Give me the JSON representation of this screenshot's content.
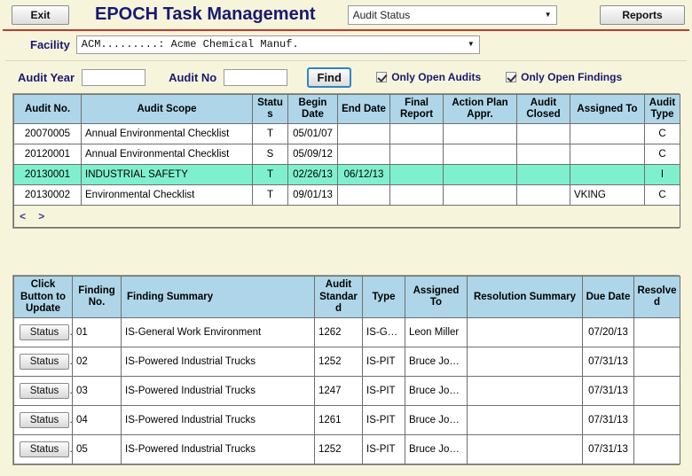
{
  "header": {
    "exit_label": "Exit",
    "app_title": "EPOCH Task Management",
    "status_select_value": "Audit Status",
    "reports_label": "Reports",
    "caret_icon": "▼"
  },
  "facility": {
    "label": "Facility",
    "value": "ACM.........: Acme Chemical Manuf.",
    "caret_icon": "▼"
  },
  "filters": {
    "audit_year_label": "Audit Year",
    "audit_year_value": "",
    "audit_no_label": "Audit No",
    "audit_no_value": "",
    "find_label": "Find",
    "only_open_audits_label": "Only Open Audits",
    "only_open_audits_checked": true,
    "only_open_findings_label": "Only Open Findings",
    "only_open_findings_checked": true
  },
  "audits_table": {
    "columns": [
      "Audit No.",
      "Audit Scope",
      "Status",
      "Begin Date",
      "End Date",
      "Final Report",
      "Action Plan Appr.",
      "Audit Closed",
      "Assigned To",
      "Audit Type"
    ],
    "rows": [
      {
        "audit_no": "20070005",
        "audit_scope": "Annual Environmental Checklist",
        "status": "T",
        "begin_date": "05/01/07",
        "end_date": "",
        "final_report": "",
        "action_plan_appr": "",
        "audit_closed": "",
        "assigned_to": "",
        "audit_type": "C",
        "selected": false
      },
      {
        "audit_no": "20120001",
        "audit_scope": "Annual Environmental Checklist",
        "status": "S",
        "begin_date": "05/09/12",
        "end_date": "",
        "final_report": "",
        "action_plan_appr": "",
        "audit_closed": "",
        "assigned_to": "",
        "audit_type": "C",
        "selected": false
      },
      {
        "audit_no": "20130001",
        "audit_scope": "INDUSTRIAL SAFETY",
        "status": "T",
        "begin_date": "02/26/13",
        "end_date": "06/12/13",
        "final_report": "",
        "action_plan_appr": "",
        "audit_closed": "",
        "assigned_to": "",
        "audit_type": "I",
        "selected": true
      },
      {
        "audit_no": "20130002",
        "audit_scope": "Environmental Checklist",
        "status": "T",
        "begin_date": "09/01/13",
        "end_date": "",
        "final_report": "",
        "action_plan_appr": "",
        "audit_closed": "",
        "assigned_to": "VKING",
        "audit_type": "C",
        "selected": false
      }
    ],
    "prev_label": "<",
    "next_label": ">"
  },
  "findings_table": {
    "columns": [
      "Click Button to Update",
      "Finding No.",
      "Finding Summary",
      "Audit Standard",
      "Type",
      "Assigned To",
      "Resolution Summary",
      "Due Date",
      "Resolved"
    ],
    "status_button_label": "Status",
    "rows": [
      {
        "finding_no": "01",
        "finding_summary": "IS-General Work Environment",
        "audit_standard": "1262",
        "type": "IS-GWE",
        "assigned_to": "Leon Miller",
        "resolution_summary": "",
        "due_date": "07/20/13",
        "resolved": ""
      },
      {
        "finding_no": "02",
        "finding_summary": "IS-Powered Industrial Trucks",
        "audit_standard": "1252",
        "type": "IS-PIT",
        "assigned_to": "Bruce Jones",
        "resolution_summary": "",
        "due_date": "07/31/13",
        "resolved": ""
      },
      {
        "finding_no": "03",
        "finding_summary": "IS-Powered Industrial Trucks",
        "audit_standard": "1247",
        "type": "IS-PIT",
        "assigned_to": "Bruce Jones",
        "resolution_summary": "",
        "due_date": "07/31/13",
        "resolved": ""
      },
      {
        "finding_no": "04",
        "finding_summary": "IS-Powered Industrial Trucks",
        "audit_standard": "1261",
        "type": "IS-PIT",
        "assigned_to": "Bruce Jones",
        "resolution_summary": "",
        "due_date": "07/31/13",
        "resolved": ""
      },
      {
        "finding_no": "05",
        "finding_summary": "IS-Powered Industrial Trucks",
        "audit_standard": "1252",
        "type": "IS-PIT",
        "assigned_to": "Bruce Jones",
        "resolution_summary": "",
        "due_date": "07/31/13",
        "resolved": ""
      }
    ]
  },
  "colors": {
    "page_bg": "#f6f5dc",
    "title_blue": "#191970",
    "header_blue": "#aed6e8",
    "selected_row": "#7ff0cd",
    "divider_red": "#c0392b"
  }
}
